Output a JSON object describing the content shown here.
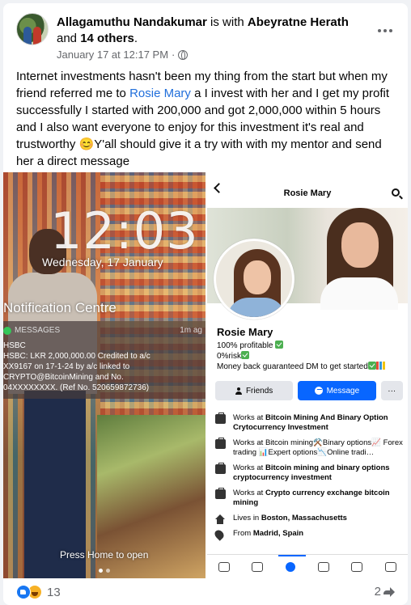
{
  "post": {
    "author": "Allagamuthu Nandakumar",
    "with_text": " is with ",
    "tagged": "Abeyratne Herath",
    "and_text": " and",
    "others": "14 others",
    "period": ".",
    "timestamp": "January 17 at 12:17 PM",
    "separator": " · ",
    "audience_icon": "globe-icon",
    "text_before_mention": "Internet investments hasn't been my thing from the start but when my friend referred me to ",
    "mention": "Rosie Mary",
    "text_after_mention": " a I invest with her and I get my profit successfully I started with 200,000 and got 2,000,000 within 5 hours and I also want everyone to enjoy for this investment it's real and trustworthy 😊Y'all should give it a try with with my mentor and send her a direct message"
  },
  "lockscreen": {
    "time": "12:03",
    "date": "Wednesday, 17 January",
    "notification_centre": "Notification Centre",
    "app": "MESSAGES",
    "age": "1m ag",
    "body": "HSBC\nHSBC: LKR 2,000,000.00 Credited to a/c\nXX9167 on 17-1-24 by a/c linked to\nCRYPTO@BitcoinMining and No.\n04XXXXXXXX. (Ref No. 520659872736)",
    "press_home": "Press Home to open"
  },
  "profile": {
    "title": "Rosie Mary",
    "name": "Rosie Mary",
    "bio_line1": "100% profitable ",
    "bio_line2": "0%risk",
    "bio_line3": "Money back guaranteed DM to get started",
    "friends_label": "Friends",
    "message_label": "Message",
    "more_label": "···",
    "details": [
      {
        "prefix": "Works at ",
        "bold": "Bitcoin Mining And Binary Option Crytocurrency Investment",
        "rest": ""
      },
      {
        "prefix": "Works at Bitcoin mining⚒️Binary options📈 Forex trading 📊Expert options📉Online tradi…",
        "bold": "",
        "rest": ""
      },
      {
        "prefix": "Works at ",
        "bold": "Bitcoin mining and binary options cryptocurrency investment",
        "rest": ""
      },
      {
        "prefix": "Works at ",
        "bold": "Crypto currency exchange bitcoin mining",
        "rest": ""
      },
      {
        "prefix": "Lives in ",
        "bold": "Boston, Massachusetts",
        "rest": ""
      },
      {
        "prefix": "From ",
        "bold": "Madrid, Spain",
        "rest": ""
      }
    ]
  },
  "footer": {
    "reaction_count": "13",
    "share_count": "2"
  },
  "colors": {
    "link": "#216fdb",
    "primary": "#0866ff",
    "secondary_text": "#65676b"
  }
}
